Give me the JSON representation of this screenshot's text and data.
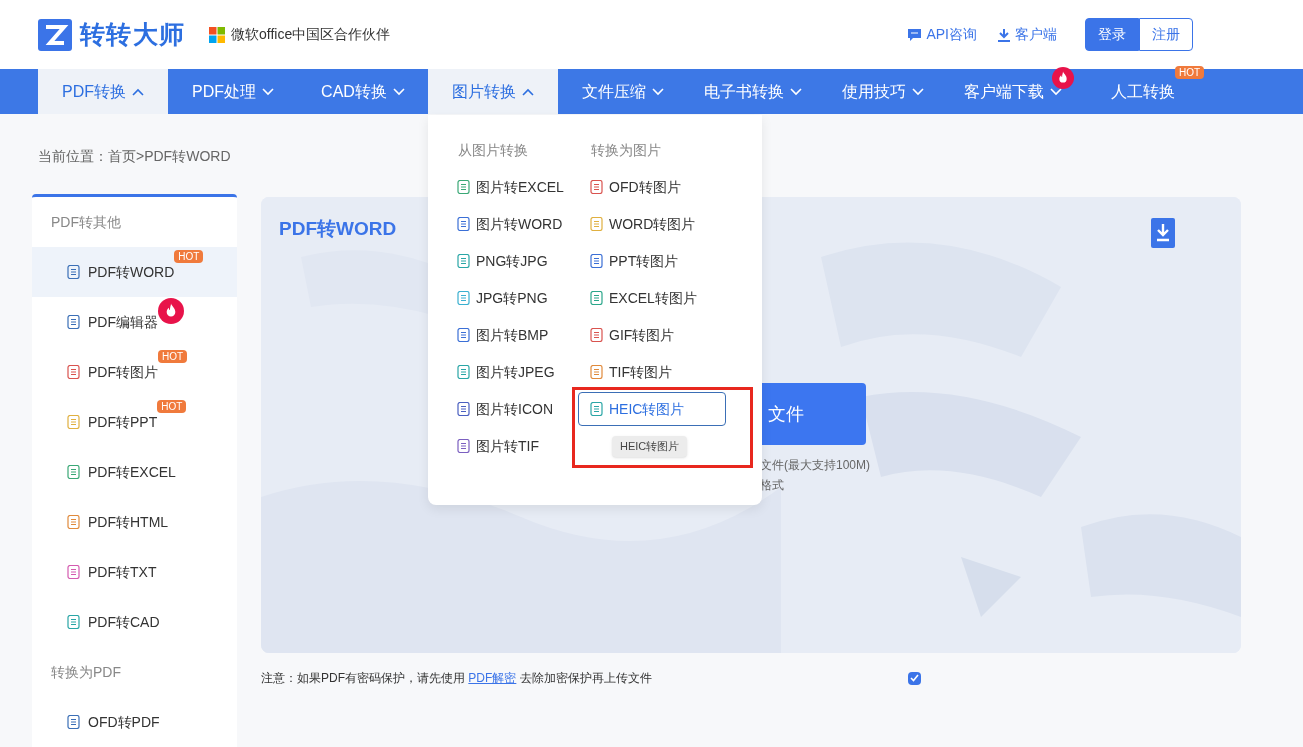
{
  "header": {
    "brand": "转转大师",
    "partner": "微软office中国区合作伙伴",
    "links": [
      "API咨询",
      "客户端"
    ],
    "login": "登录",
    "register": "注册"
  },
  "nav": [
    {
      "label": "PDF转换",
      "selected": true,
      "expanded": true
    },
    {
      "label": "PDF处理",
      "selected": false,
      "expanded": false
    },
    {
      "label": "CAD转换",
      "selected": false,
      "expanded": false
    },
    {
      "label": "图片转换",
      "selected": true,
      "expanded": true
    },
    {
      "label": "文件压缩",
      "selected": false,
      "expanded": false
    },
    {
      "label": "电子书转换",
      "selected": false,
      "expanded": false
    },
    {
      "label": "使用技巧",
      "selected": false,
      "expanded": false
    },
    {
      "label": "客户端下载",
      "selected": false,
      "expanded": false,
      "flame": true
    },
    {
      "label": "人工转换",
      "selected": false,
      "badge": "HOT"
    }
  ],
  "breadcrumb": "当前位置：首页>PDF转WORD",
  "sidebar": [
    {
      "kind": "group",
      "label": "PDF转其他"
    },
    {
      "kind": "item",
      "label": "PDF转WORD",
      "selected": true,
      "color": "#3b6fb6",
      "badge": "HOT"
    },
    {
      "kind": "item",
      "label": "PDF编辑器",
      "selected": false,
      "color": "#3b6fb6",
      "flame": true
    },
    {
      "kind": "item",
      "label": "PDF转图片",
      "selected": false,
      "color": "#d9534f",
      "badge": "HOT"
    },
    {
      "kind": "item",
      "label": "PDF转PPT",
      "selected": false,
      "color": "#e0b040",
      "badge": "HOT"
    },
    {
      "kind": "item",
      "label": "PDF转EXCEL",
      "selected": false,
      "color": "#3aa876"
    },
    {
      "kind": "item",
      "label": "PDF转HTML",
      "selected": false,
      "color": "#e08a3c"
    },
    {
      "kind": "item",
      "label": "PDF转TXT",
      "selected": false,
      "color": "#d45bb0"
    },
    {
      "kind": "item",
      "label": "PDF转CAD",
      "selected": false,
      "color": "#2aa6a6"
    },
    {
      "kind": "group",
      "label": "转换为PDF"
    },
    {
      "kind": "item",
      "label": "OFD转PDF",
      "selected": false,
      "color": "#3b6fb6"
    }
  ],
  "main": {
    "title": "PDF转WORD",
    "upload_button": "文件",
    "hint_lines": [
      "文件(最大支持100M)",
      "格式"
    ],
    "notice": "注意：如果PDF有密码保护，请先使用 ",
    "notice_link": "PDF解密",
    "notice_end": " 去除加密保护再上传文件",
    "agree_checked": true
  },
  "dropdown": {
    "columns": [
      {
        "heading": "从图片转换",
        "items": [
          {
            "label": "图片转EXCEL",
            "selected": false,
            "color": "#3aa876"
          },
          {
            "label": "图片转WORD",
            "selected": false,
            "color": "#3b6fd6"
          },
          {
            "label": "PNG转JPG",
            "selected": false,
            "color": "#2aa6a6"
          },
          {
            "label": "JPG转PNG",
            "selected": false,
            "color": "#3ab0d0"
          },
          {
            "label": "图片转BMP",
            "selected": false,
            "color": "#3b6fd6"
          },
          {
            "label": "图片转JPEG",
            "selected": false,
            "color": "#2aa6a6"
          },
          {
            "label": "图片转ICON",
            "selected": false,
            "color": "#4a5fc0"
          },
          {
            "label": "图片转TIF",
            "selected": false,
            "color": "#7b5fc0"
          }
        ]
      },
      {
        "heading": "转换为图片",
        "items": [
          {
            "label": "OFD转图片",
            "selected": false,
            "color": "#d9534f"
          },
          {
            "label": "WORD转图片",
            "selected": false,
            "color": "#e0b040"
          },
          {
            "label": "PPT转图片",
            "selected": false,
            "color": "#3b6fd6"
          },
          {
            "label": "EXCEL转图片",
            "selected": false,
            "color": "#2aa68a"
          },
          {
            "label": "GIF转图片",
            "selected": false,
            "color": "#d9534f"
          },
          {
            "label": "TIF转图片",
            "selected": false,
            "color": "#e08a3c"
          },
          {
            "label": "HEIC转图片",
            "selected": true,
            "color": "#2aa6a6",
            "tooltip": "HEIC转图片"
          }
        ]
      }
    ]
  }
}
